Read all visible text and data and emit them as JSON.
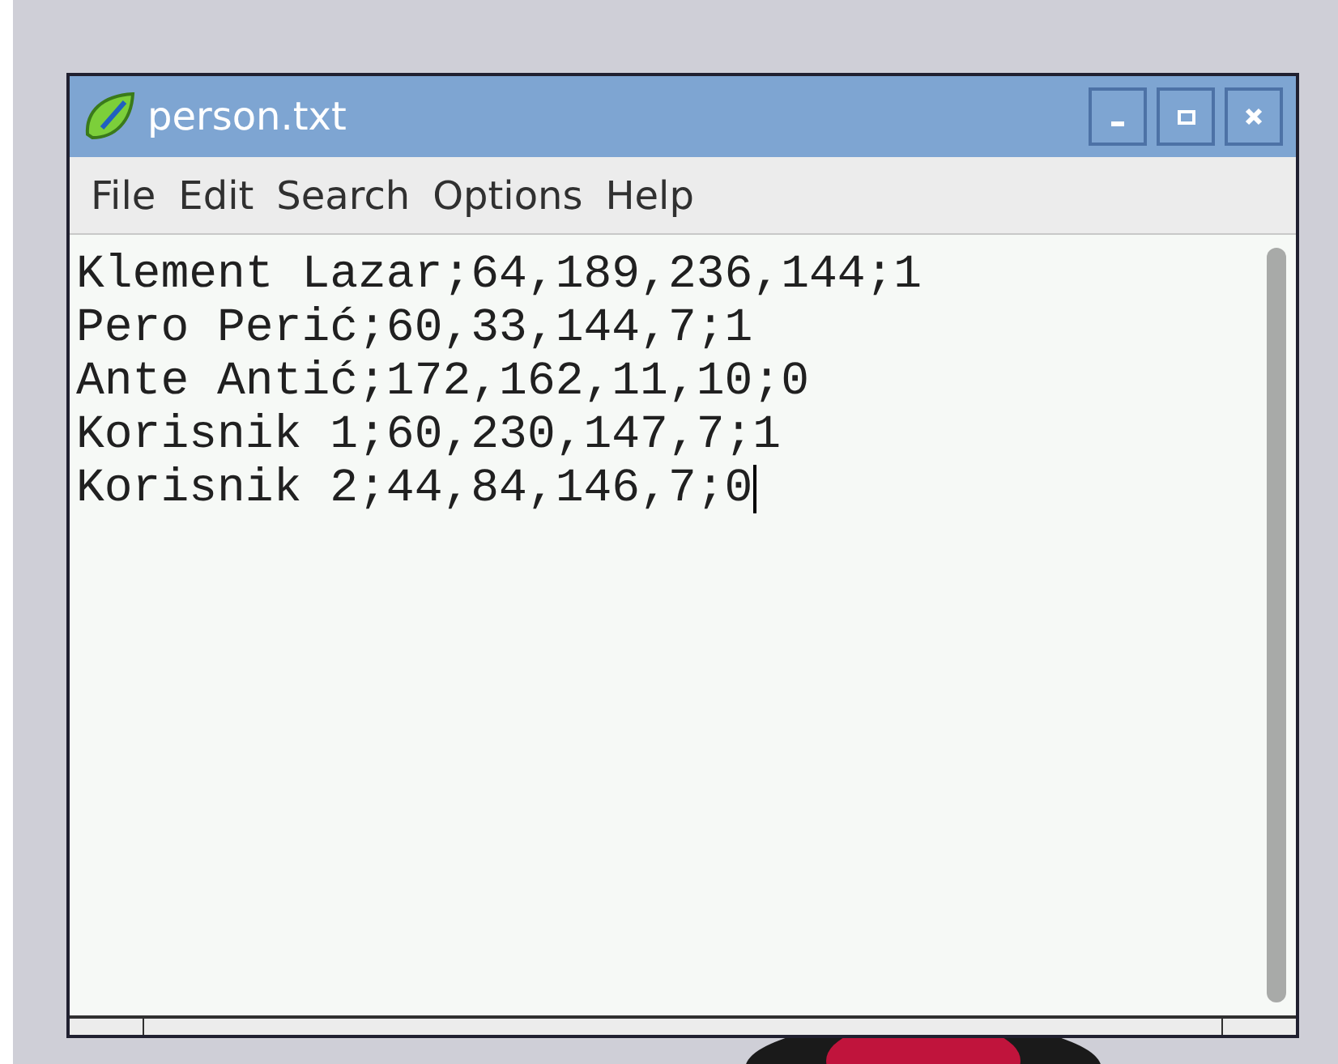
{
  "window": {
    "title": "person.txt"
  },
  "menu": [
    "File",
    "Edit",
    "Search",
    "Options",
    "Help"
  ],
  "editor": {
    "lines": [
      {
        "text": "Klement Lazar;64,189,236,144;1",
        "caret": false
      },
      {
        "text": "Pero Perić;60,33,144,7;1",
        "caret": false
      },
      {
        "text": "Ante Antić;172,162,11,10;0",
        "caret": false
      },
      {
        "text": "Korisnik 1;60,230,147,7;1",
        "caret": false
      },
      {
        "text": "Korisnik 2;44,84,146,7;0",
        "caret": true
      }
    ]
  }
}
